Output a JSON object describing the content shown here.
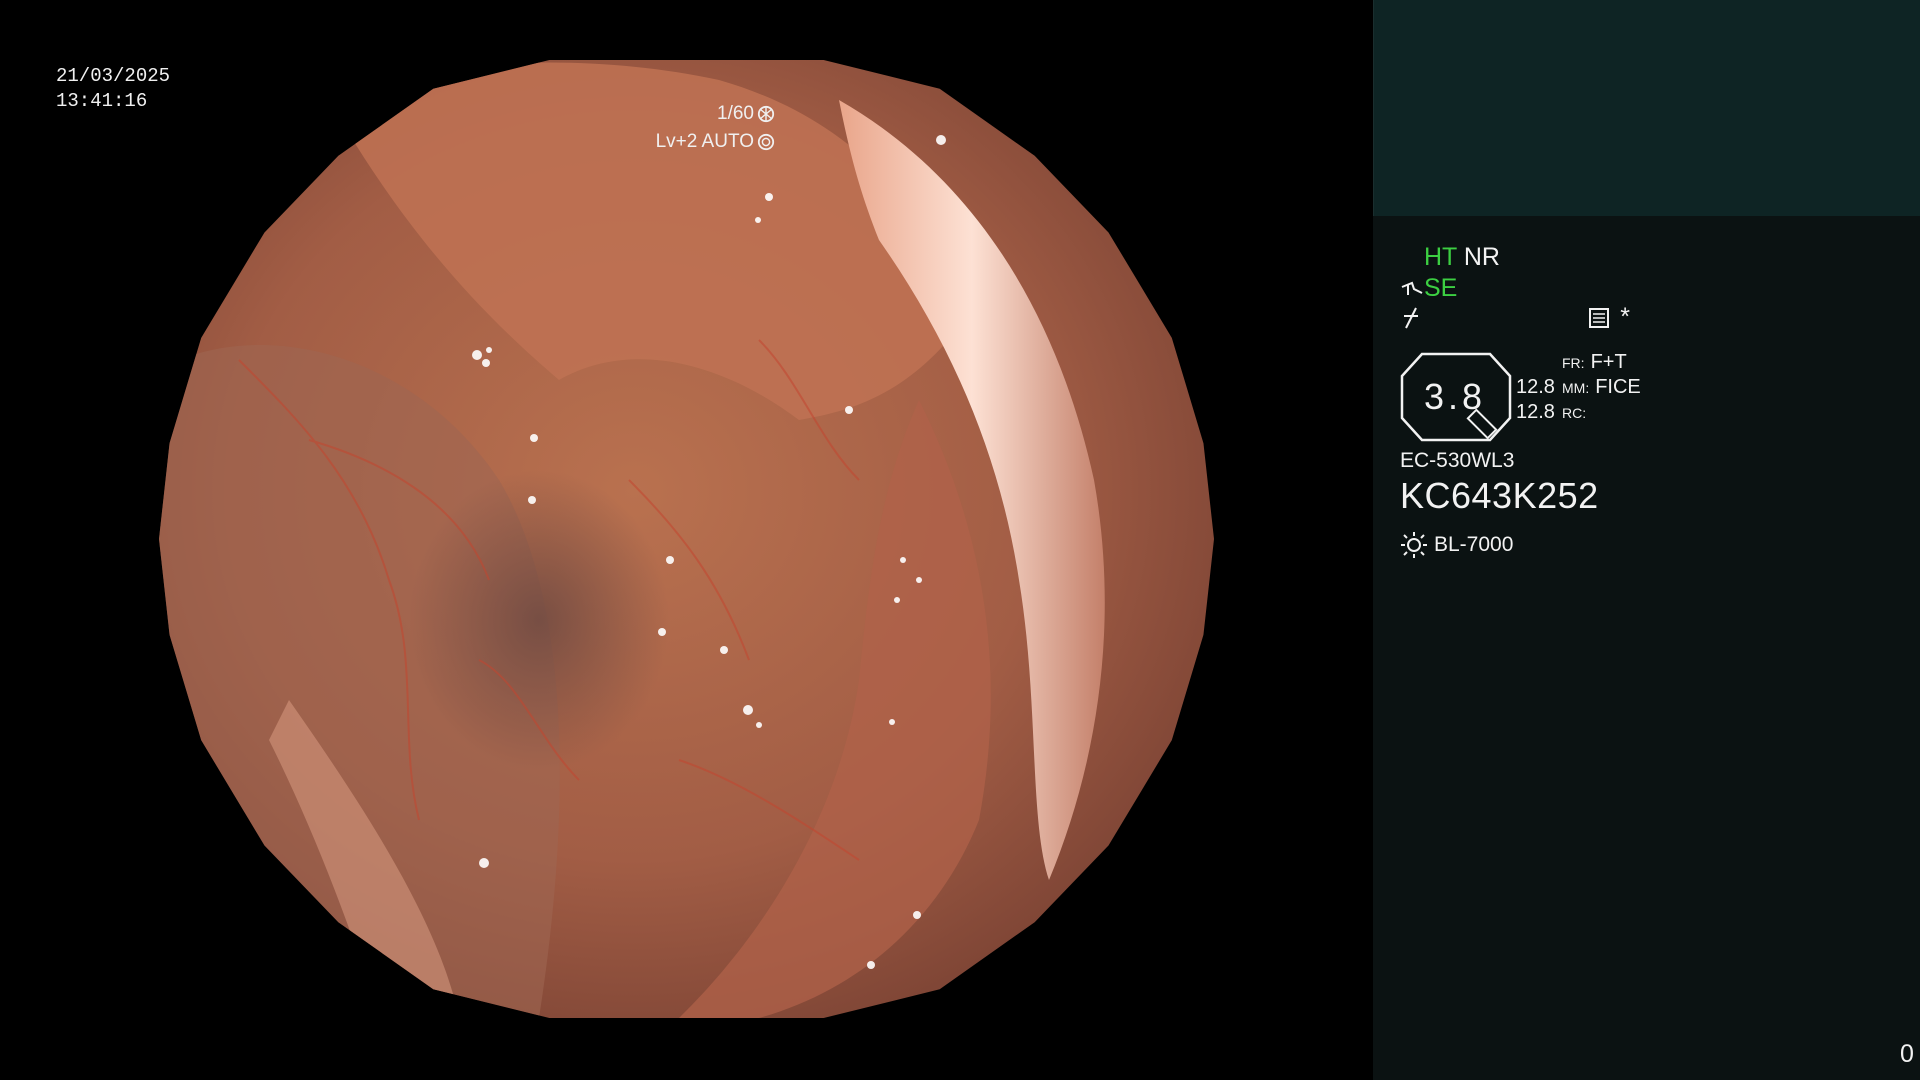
{
  "timestamp": {
    "date": "21/03/2025",
    "time": "13:41:16"
  },
  "exposure": {
    "shutter": "1/60",
    "mode": "Lv+2 AUTO",
    "shutter_icon": "shutter-icon",
    "mode_icon": "iris-icon"
  },
  "status": {
    "ht": "HT",
    "nr": "NR",
    "se": "SE",
    "ht_color": "#3ccf42",
    "se_color": "#3ccf42",
    "se_icon": "structure-enhancement-icon",
    "color_icon": "color-enhancement-icon",
    "memo_icon": "memo-icon",
    "star": "*"
  },
  "enhancement": {
    "value": "3.8",
    "rows": [
      {
        "num": "",
        "key": "FR:",
        "val": "F+T"
      },
      {
        "num": "12.8",
        "key": "MM:",
        "val": "FICE"
      },
      {
        "num": "12.8",
        "key": "RC:",
        "val": ""
      }
    ]
  },
  "scope": {
    "model": "EC-530WL3",
    "serial": "KC643K252"
  },
  "light": {
    "model": "BL-7000",
    "icon": "lamp-icon"
  },
  "counter": "0",
  "colors": {
    "panel_bg": "#0b1212",
    "panel_top_bg": "#0e2424",
    "mucosa": "#b0644a"
  }
}
